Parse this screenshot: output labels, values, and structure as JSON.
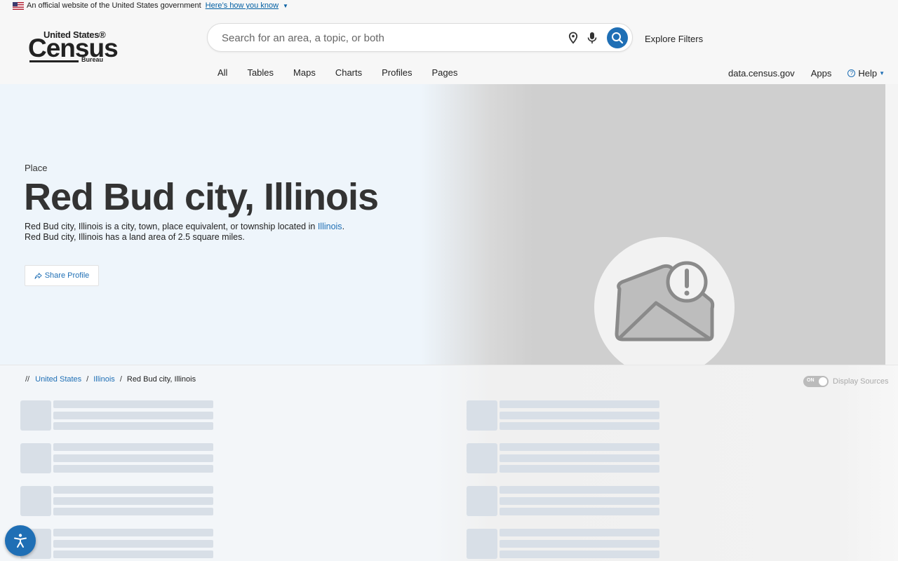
{
  "gov_banner": {
    "text": "An official website of the United States government",
    "link": "Here’s how you know"
  },
  "logo": {
    "line1": "United States®",
    "line2": "Census",
    "line3": "Bureau"
  },
  "search": {
    "placeholder": "Search for an area, a topic, or both"
  },
  "header": {
    "explore_filters": "Explore Filters",
    "tabs": [
      "All",
      "Tables",
      "Maps",
      "Charts",
      "Profiles",
      "Pages"
    ],
    "right_links": [
      "data.census.gov",
      "Apps"
    ],
    "help": "Help"
  },
  "hero": {
    "label": "Place",
    "title": "Red Bud city, Illinois",
    "desc_line1_prefix": "Red Bud city, Illinois is a city, town, place equivalent, or township located in ",
    "desc_line1_link": "Illinois",
    "desc_line1_suffix": ".",
    "desc_line2": "Red Bud city, Illinois has a land area of 2.5 square miles.",
    "share_label": "Share Profile"
  },
  "breadcrumb": {
    "prefix": "//",
    "items": [
      "United States",
      "Illinois"
    ],
    "current": "Red Bud city, Illinois"
  },
  "display_sources": {
    "toggle_state": "ON",
    "label": "Display Sources"
  },
  "colors": {
    "accent": "#1f6fb5",
    "skeleton": "#d8dfe7"
  }
}
